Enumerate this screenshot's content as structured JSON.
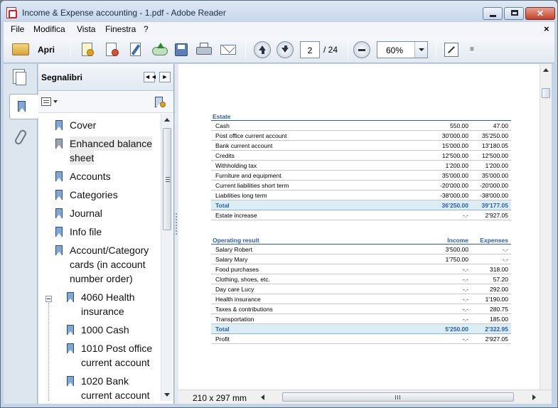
{
  "window": {
    "title": "Income & Expense accounting - 1.pdf - Adobe Reader",
    "close_glyph": "✕",
    "doc_close_glyph": "×"
  },
  "menu": {
    "file": "File",
    "modifica": "Modifica",
    "vista": "Vista",
    "finestra": "Finestra",
    "help": "?"
  },
  "toolbar": {
    "open_label": "Apri",
    "page_current": "2",
    "page_total": "/ 24",
    "zoom": "60%",
    "more_glyph": "≡"
  },
  "panel": {
    "title": "Segnalibri",
    "collapse_glyph": "◄◄",
    "next_glyph": "►"
  },
  "bookmarks": [
    {
      "lines": [
        "Cover"
      ]
    },
    {
      "lines": [
        "Enhanced balance",
        "sheet"
      ],
      "selected": true
    },
    {
      "lines": [
        "Accounts"
      ]
    },
    {
      "lines": [
        "Categories"
      ]
    },
    {
      "lines": [
        "Journal"
      ]
    },
    {
      "lines": [
        "Info file"
      ]
    },
    {
      "lines": [
        "Account/Category",
        "cards (in account",
        "number order)"
      ],
      "expanded": true
    },
    {
      "lines": [
        "4060 Health",
        "insurance"
      ],
      "child": true
    },
    {
      "lines": [
        "1000 Cash"
      ],
      "child": true
    },
    {
      "lines": [
        "1010 Post office",
        "current account"
      ],
      "child": true
    },
    {
      "lines": [
        "1020 Bank",
        "current account"
      ],
      "child": true
    }
  ],
  "status": {
    "page_size": "210 x 297 mm"
  },
  "estate": {
    "header": "Estate",
    "rows": [
      {
        "label": "Cash",
        "v1": "550.00",
        "v2": "47.00"
      },
      {
        "label": "Post office current account",
        "v1": "30'000.00",
        "v2": "35'250.00"
      },
      {
        "label": "Bank current account",
        "v1": "15'000.00",
        "v2": "13'180.05"
      },
      {
        "label": "Credits",
        "v1": "12'500.00",
        "v2": "12'500.00"
      },
      {
        "label": "Withholding tax",
        "v1": "1'200.00",
        "v2": "1'200.00"
      },
      {
        "label": "Furniture and equipment",
        "v1": "35'000.00",
        "v2": "35'000.00"
      },
      {
        "label": "Current liabilities short term",
        "v1": "-20'000.00",
        "v2": "-20'000.00"
      },
      {
        "label": "Liabilities long term",
        "v1": "-38'000.00",
        "v2": "-38'000.00"
      }
    ],
    "total": {
      "label": "Total",
      "v1": "36'250.00",
      "v2": "39'177.05"
    },
    "after": {
      "label": "Estate increase",
      "v1": "-.-",
      "v2": "2'927.05"
    }
  },
  "operating": {
    "header": "Operating result",
    "col1": "Income",
    "col2": "Expenses",
    "rows": [
      {
        "label": "Salary Robert",
        "v1": "3'500.00",
        "v2": "-.-"
      },
      {
        "label": "Salary Mary",
        "v1": "1'750.00",
        "v2": "-.-"
      },
      {
        "label": "Food purchases",
        "v1": "-.-",
        "v2": "318.00"
      },
      {
        "label": "Clothing, shoes, etc.",
        "v1": "-.-",
        "v2": "57.20"
      },
      {
        "label": "Day care Lucy",
        "v1": "-.-",
        "v2": "292.00"
      },
      {
        "label": "Health insurance",
        "v1": "-.-",
        "v2": "1'190.00"
      },
      {
        "label": "Taxes & contributions",
        "v1": "-.-",
        "v2": "280.75"
      },
      {
        "label": "Transportation",
        "v1": "-.-",
        "v2": "185.00"
      }
    ],
    "total": {
      "label": "Total",
      "v1": "5'250.00",
      "v2": "2'322.95"
    },
    "after": {
      "label": "Profit",
      "v1": "-.-",
      "v2": "2'927.05"
    }
  }
}
